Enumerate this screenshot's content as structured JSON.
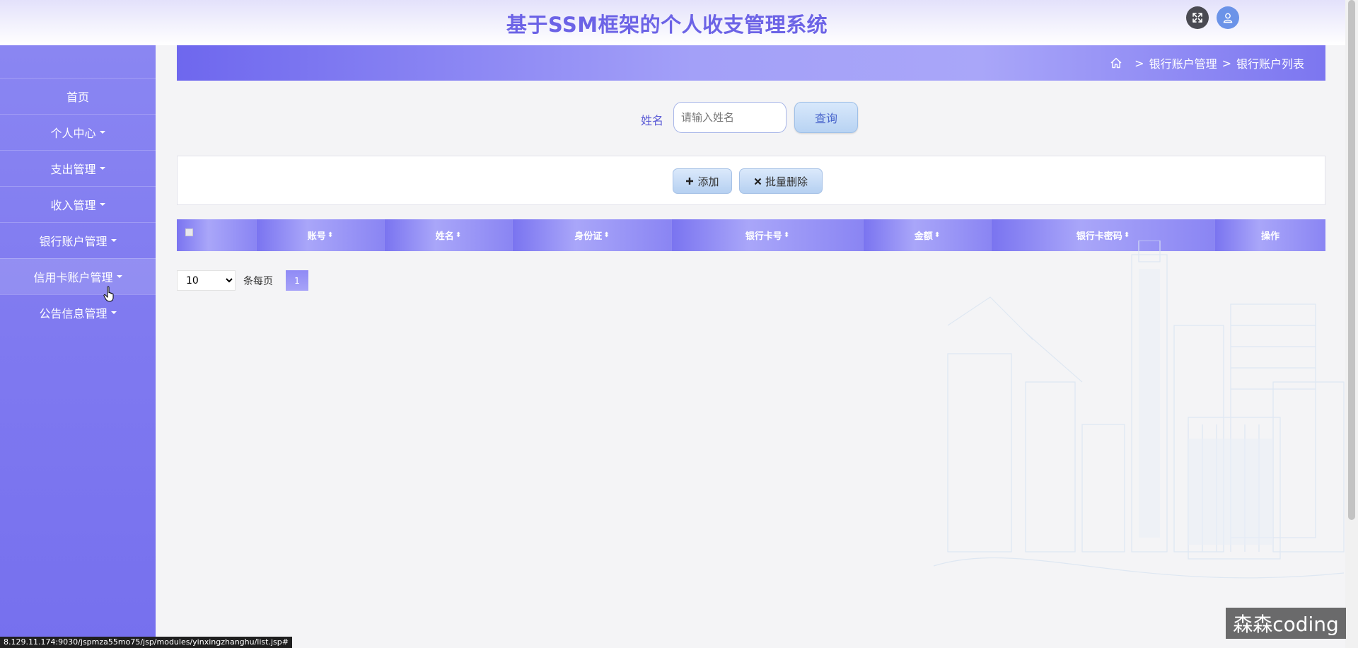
{
  "header": {
    "title": "基于SSM框架的个人收支管理系统"
  },
  "sidebar": {
    "items": [
      {
        "label": "首页"
      },
      {
        "label": "个人中心"
      },
      {
        "label": "支出管理"
      },
      {
        "label": "收入管理"
      },
      {
        "label": "银行账户管理"
      },
      {
        "label": "信用卡账户管理"
      },
      {
        "label": "公告信息管理"
      }
    ]
  },
  "breadcrumb": {
    "level1": "银行账户管理",
    "level2": "银行账户列表",
    "separator": ">"
  },
  "search": {
    "label": "姓名",
    "placeholder": "请输入姓名",
    "value": "",
    "button": "查询"
  },
  "actions": {
    "add": "添加",
    "batch_delete": "批量删除"
  },
  "table": {
    "columns": [
      "账号",
      "姓名",
      "身份证",
      "银行卡号",
      "金额",
      "银行卡密码",
      "操作"
    ]
  },
  "pagination": {
    "page_size": "10",
    "per_page_label": "条每页",
    "current_page": "1"
  },
  "status_url": "8.129.11.174:9030/jspmza55mo75/jsp/modules/yinxingzhanghu/list.jsp#",
  "watermark": "森森coding",
  "colors": {
    "accent": "#6c63e6",
    "sidebar": "#7f79f0",
    "button": "#b8d3f3"
  }
}
